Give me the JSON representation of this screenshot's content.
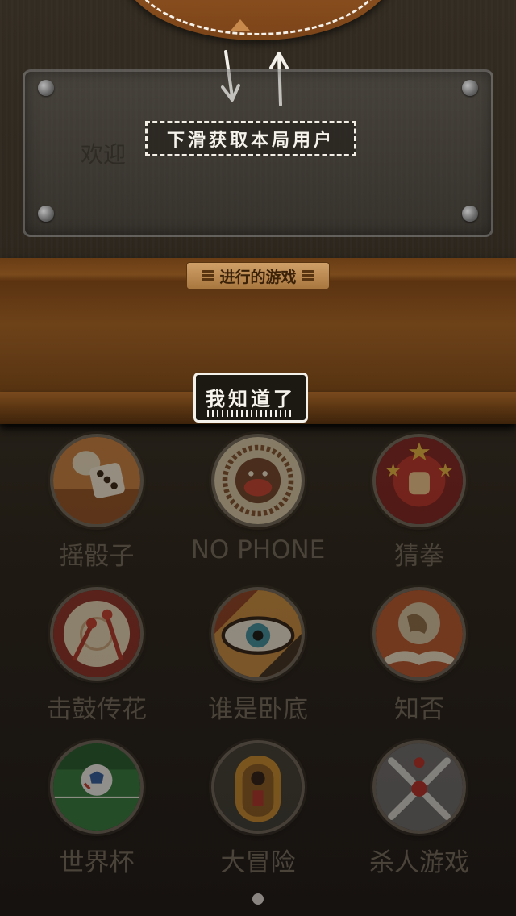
{
  "tutorial": {
    "swipe_hint": "下滑获取本局用户",
    "got_it_label": "我知道了"
  },
  "welcome": {
    "text": "欢迎"
  },
  "shelf": {
    "label": "进行的游戏"
  },
  "games": [
    {
      "label": "摇骰子",
      "icon": "dice-icon"
    },
    {
      "label": "NO PHONE",
      "icon": "gorilla-icon"
    },
    {
      "label": "猜拳",
      "icon": "fist-icon"
    },
    {
      "label": "击鼓传花",
      "icon": "drum-icon"
    },
    {
      "label": "谁是卧底",
      "icon": "eye-icon"
    },
    {
      "label": "知否",
      "icon": "globe-book-icon"
    },
    {
      "label": "世界杯",
      "icon": "soccer-ball-icon"
    },
    {
      "label": "大冒险",
      "icon": "door-icon"
    },
    {
      "label": "杀人游戏",
      "icon": "crossed-knives-icon"
    }
  ],
  "pager": {
    "pages": 1,
    "active": 1
  }
}
